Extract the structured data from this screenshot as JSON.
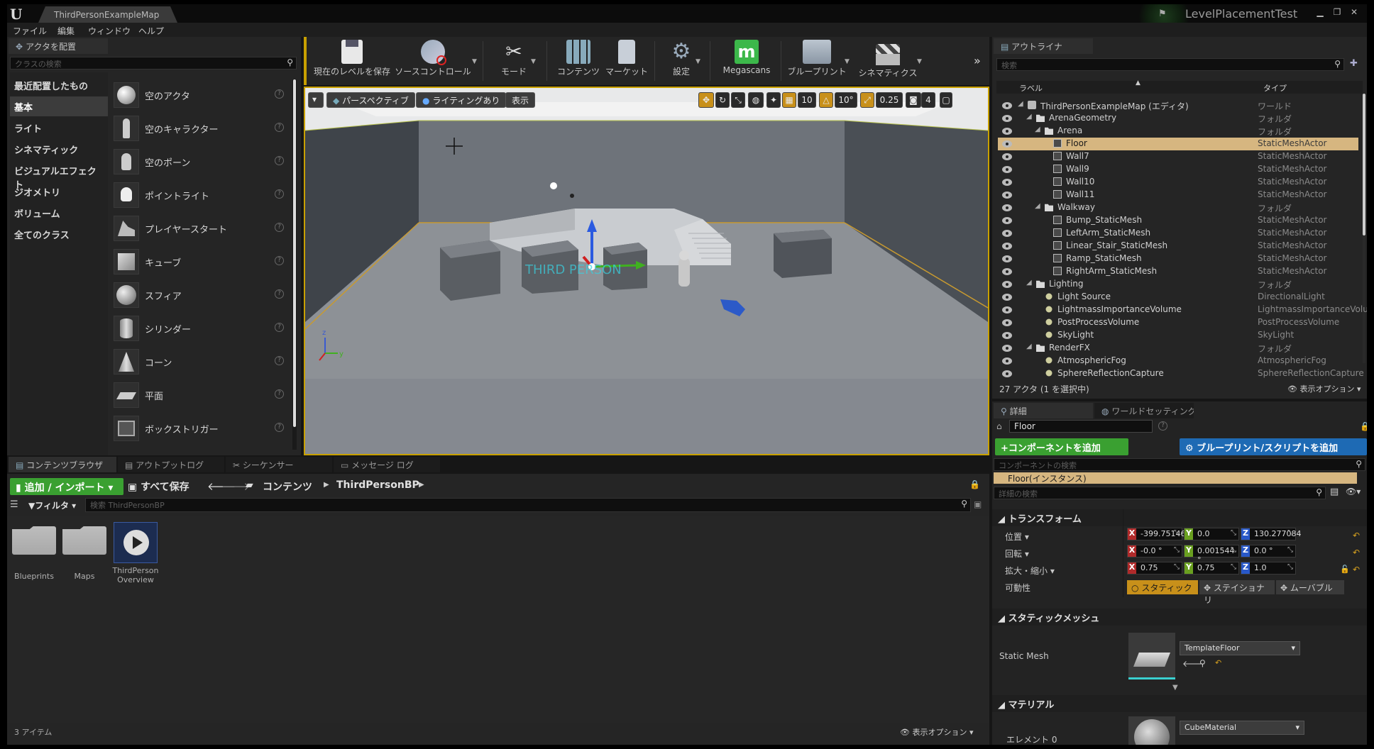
{
  "title_bar": {
    "level_tab": "ThirdPersonExampleMap",
    "project_name": "LevelPlacementTest"
  },
  "menu": [
    "ファイル",
    "編集",
    "ウィンドウ",
    "ヘルプ"
  ],
  "place_actors": {
    "tab": "アクタを配置",
    "search_placeholder": "クラスの検索",
    "categories": [
      "最近配置したもの",
      "基本",
      "ライト",
      "シネマティック",
      "ビジュアルエフェクト",
      "ジオメトリ",
      "ボリューム",
      "全てのクラス"
    ],
    "active_category": "基本",
    "items": [
      "空のアクタ",
      "空のキャラクター",
      "空のポーン",
      "ポイントライト",
      "プレイヤースタート",
      "キューブ",
      "スフィア",
      "シリンダー",
      "コーン",
      "平面",
      "ボックストリガー"
    ]
  },
  "toolbar": {
    "buttons": [
      "現在のレベルを保存",
      "ソースコントロール",
      "モード",
      "コンテンツ",
      "マーケット",
      "設定",
      "Megascans",
      "ブループリント",
      "シネマティクス"
    ]
  },
  "viewport": {
    "perspective": "パースペクティブ",
    "lighting": "ライティングあり",
    "show": "表示",
    "grid_snap": "10",
    "rotation_snap": "10°",
    "scale_snap": "0.25",
    "camera_speed": "4"
  },
  "outliner": {
    "tab": "アウトライナ",
    "search_placeholder": "検索",
    "col_label": "ラベル",
    "col_type": "タイプ",
    "rows": [
      {
        "name": "ThirdPersonExampleMap (エディタ)",
        "type": "ワールド",
        "depth": 0,
        "kind": "world"
      },
      {
        "name": "ArenaGeometry",
        "type": "フォルダ",
        "depth": 1,
        "kind": "folder"
      },
      {
        "name": "Arena",
        "type": "フォルダ",
        "depth": 2,
        "kind": "folder"
      },
      {
        "name": "Floor",
        "type": "StaticMeshActor",
        "depth": 3,
        "kind": "mesh",
        "selected": true
      },
      {
        "name": "Wall7",
        "type": "StaticMeshActor",
        "depth": 3,
        "kind": "mesh"
      },
      {
        "name": "Wall9",
        "type": "StaticMeshActor",
        "depth": 3,
        "kind": "mesh"
      },
      {
        "name": "Wall10",
        "type": "StaticMeshActor",
        "depth": 3,
        "kind": "mesh"
      },
      {
        "name": "Wall11",
        "type": "StaticMeshActor",
        "depth": 3,
        "kind": "mesh"
      },
      {
        "name": "Walkway",
        "type": "フォルダ",
        "depth": 2,
        "kind": "folder"
      },
      {
        "name": "Bump_StaticMesh",
        "type": "StaticMeshActor",
        "depth": 3,
        "kind": "mesh"
      },
      {
        "name": "LeftArm_StaticMesh",
        "type": "StaticMeshActor",
        "depth": 3,
        "kind": "mesh"
      },
      {
        "name": "Linear_Stair_StaticMesh",
        "type": "StaticMeshActor",
        "depth": 3,
        "kind": "mesh"
      },
      {
        "name": "Ramp_StaticMesh",
        "type": "StaticMeshActor",
        "depth": 3,
        "kind": "mesh"
      },
      {
        "name": "RightArm_StaticMesh",
        "type": "StaticMeshActor",
        "depth": 3,
        "kind": "mesh"
      },
      {
        "name": "Lighting",
        "type": "フォルダ",
        "depth": 1,
        "kind": "folder"
      },
      {
        "name": "Light Source",
        "type": "DirectionalLight",
        "depth": 2,
        "kind": "light"
      },
      {
        "name": "LightmassImportanceVolume",
        "type": "LightmassImportanceVolu",
        "depth": 2,
        "kind": "light"
      },
      {
        "name": "PostProcessVolume",
        "type": "PostProcessVolume",
        "depth": 2,
        "kind": "light"
      },
      {
        "name": "SkyLight",
        "type": "SkyLight",
        "depth": 2,
        "kind": "light"
      },
      {
        "name": "RenderFX",
        "type": "フォルダ",
        "depth": 1,
        "kind": "folder"
      },
      {
        "name": "AtmosphericFog",
        "type": "AtmosphericFog",
        "depth": 2,
        "kind": "light"
      },
      {
        "name": "SphereReflectionCapture",
        "type": "SphereReflectionCapture",
        "depth": 2,
        "kind": "light"
      }
    ],
    "status": "27 アクタ (1 を選択中)",
    "view_options": "表示オプション"
  },
  "details": {
    "tab_details": "詳細",
    "tab_world": "ワールドセッティング",
    "name_value": "Floor",
    "add_component": "+コンポーネントを追加",
    "blueprint_button": "ブループリント/スクリプトを追加",
    "component_search": "コンポーネントの検索",
    "instance": "Floor(インスタンス)",
    "detail_search": "詳細の検索",
    "transform_header": "トランスフォーム",
    "location_label": "位置",
    "rotation_label": "回転",
    "scale_label": "拡大・縮小",
    "mobility_label": "可動性",
    "location": [
      "-399.751465",
      "0.0",
      "130.277084"
    ],
    "rotation": [
      "-0.0 °",
      "0.001544 °",
      "0.0 °"
    ],
    "scale": [
      "0.75",
      "0.75",
      "1.0"
    ],
    "mobility": [
      "スタティック",
      "ステイショナリ",
      "ムーバブル"
    ],
    "static_mesh_header": "スタティックメッシュ",
    "static_mesh_label": "Static Mesh",
    "static_mesh_value": "TemplateFloor",
    "materials_header": "マテリアル",
    "element_label": "エレメント 0",
    "material_value": "CubeMaterial"
  },
  "content_browser": {
    "tabs": [
      "コンテンツブラウザ",
      "アウトプットログ",
      "シーケンサー",
      "メッセージ ログ"
    ],
    "add_import": "追加 / インポート",
    "save_all": "すべて保存",
    "path": [
      "コンテンツ",
      "ThirdPersonBP"
    ],
    "filters": "フィルタ",
    "search_placeholder": "検索 ThirdPersonBP",
    "items": [
      "Blueprints",
      "Maps",
      "ThirdPerson Overview"
    ],
    "item_count": "3 アイテム",
    "view_options": "表示オプション"
  },
  "colors": {
    "selection": "#d6b680",
    "viewport_border": "#c8a000",
    "add_component_green": "#3aa031",
    "blueprint_blue": "#1e6ab4"
  }
}
